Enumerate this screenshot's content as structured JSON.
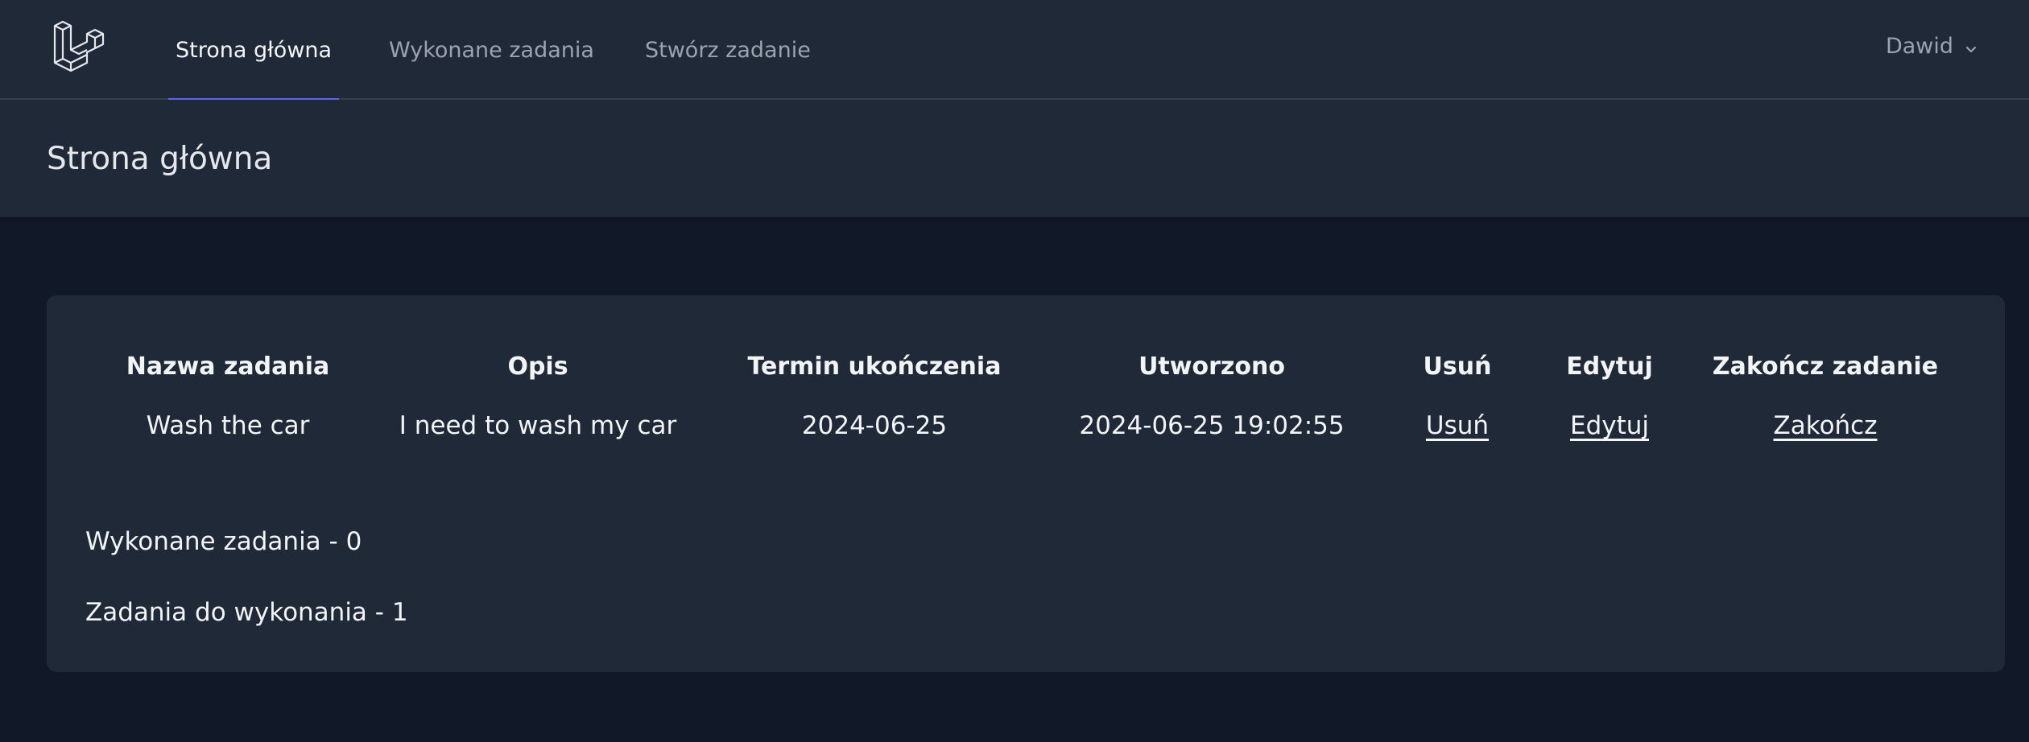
{
  "nav": {
    "logo_icon": "laravel-logo-icon",
    "links": [
      {
        "label": "Strona główna",
        "active": true
      },
      {
        "label": "Wykonane zadania",
        "active": false
      },
      {
        "label": "Stwórz zadanie",
        "active": false
      }
    ],
    "user": {
      "name": "Dawid",
      "icon": "chevron-down-icon"
    }
  },
  "header": {
    "title": "Strona główna"
  },
  "table": {
    "headers": [
      "Nazwa zadania",
      "Opis",
      "Termin ukończenia",
      "Utworzono",
      "Usuń",
      "Edytuj",
      "Zakończ zadanie"
    ],
    "rows": [
      {
        "name": "Wash the car",
        "description": "I need to wash my car",
        "deadline": "2024-06-25",
        "created": "2024-06-25 19:02:55",
        "delete_label": "Usuń",
        "edit_label": "Edytuj",
        "finish_label": "Zakończ"
      }
    ]
  },
  "summary": {
    "done": "Wykonane zadania - 0",
    "todo": "Zadania do wykonania - 1"
  },
  "colors": {
    "nav_bg": "#1f2937",
    "page_bg": "#111827",
    "accent": "#6366f1",
    "text": "#f3f4f6",
    "muted": "#9ca3af"
  }
}
